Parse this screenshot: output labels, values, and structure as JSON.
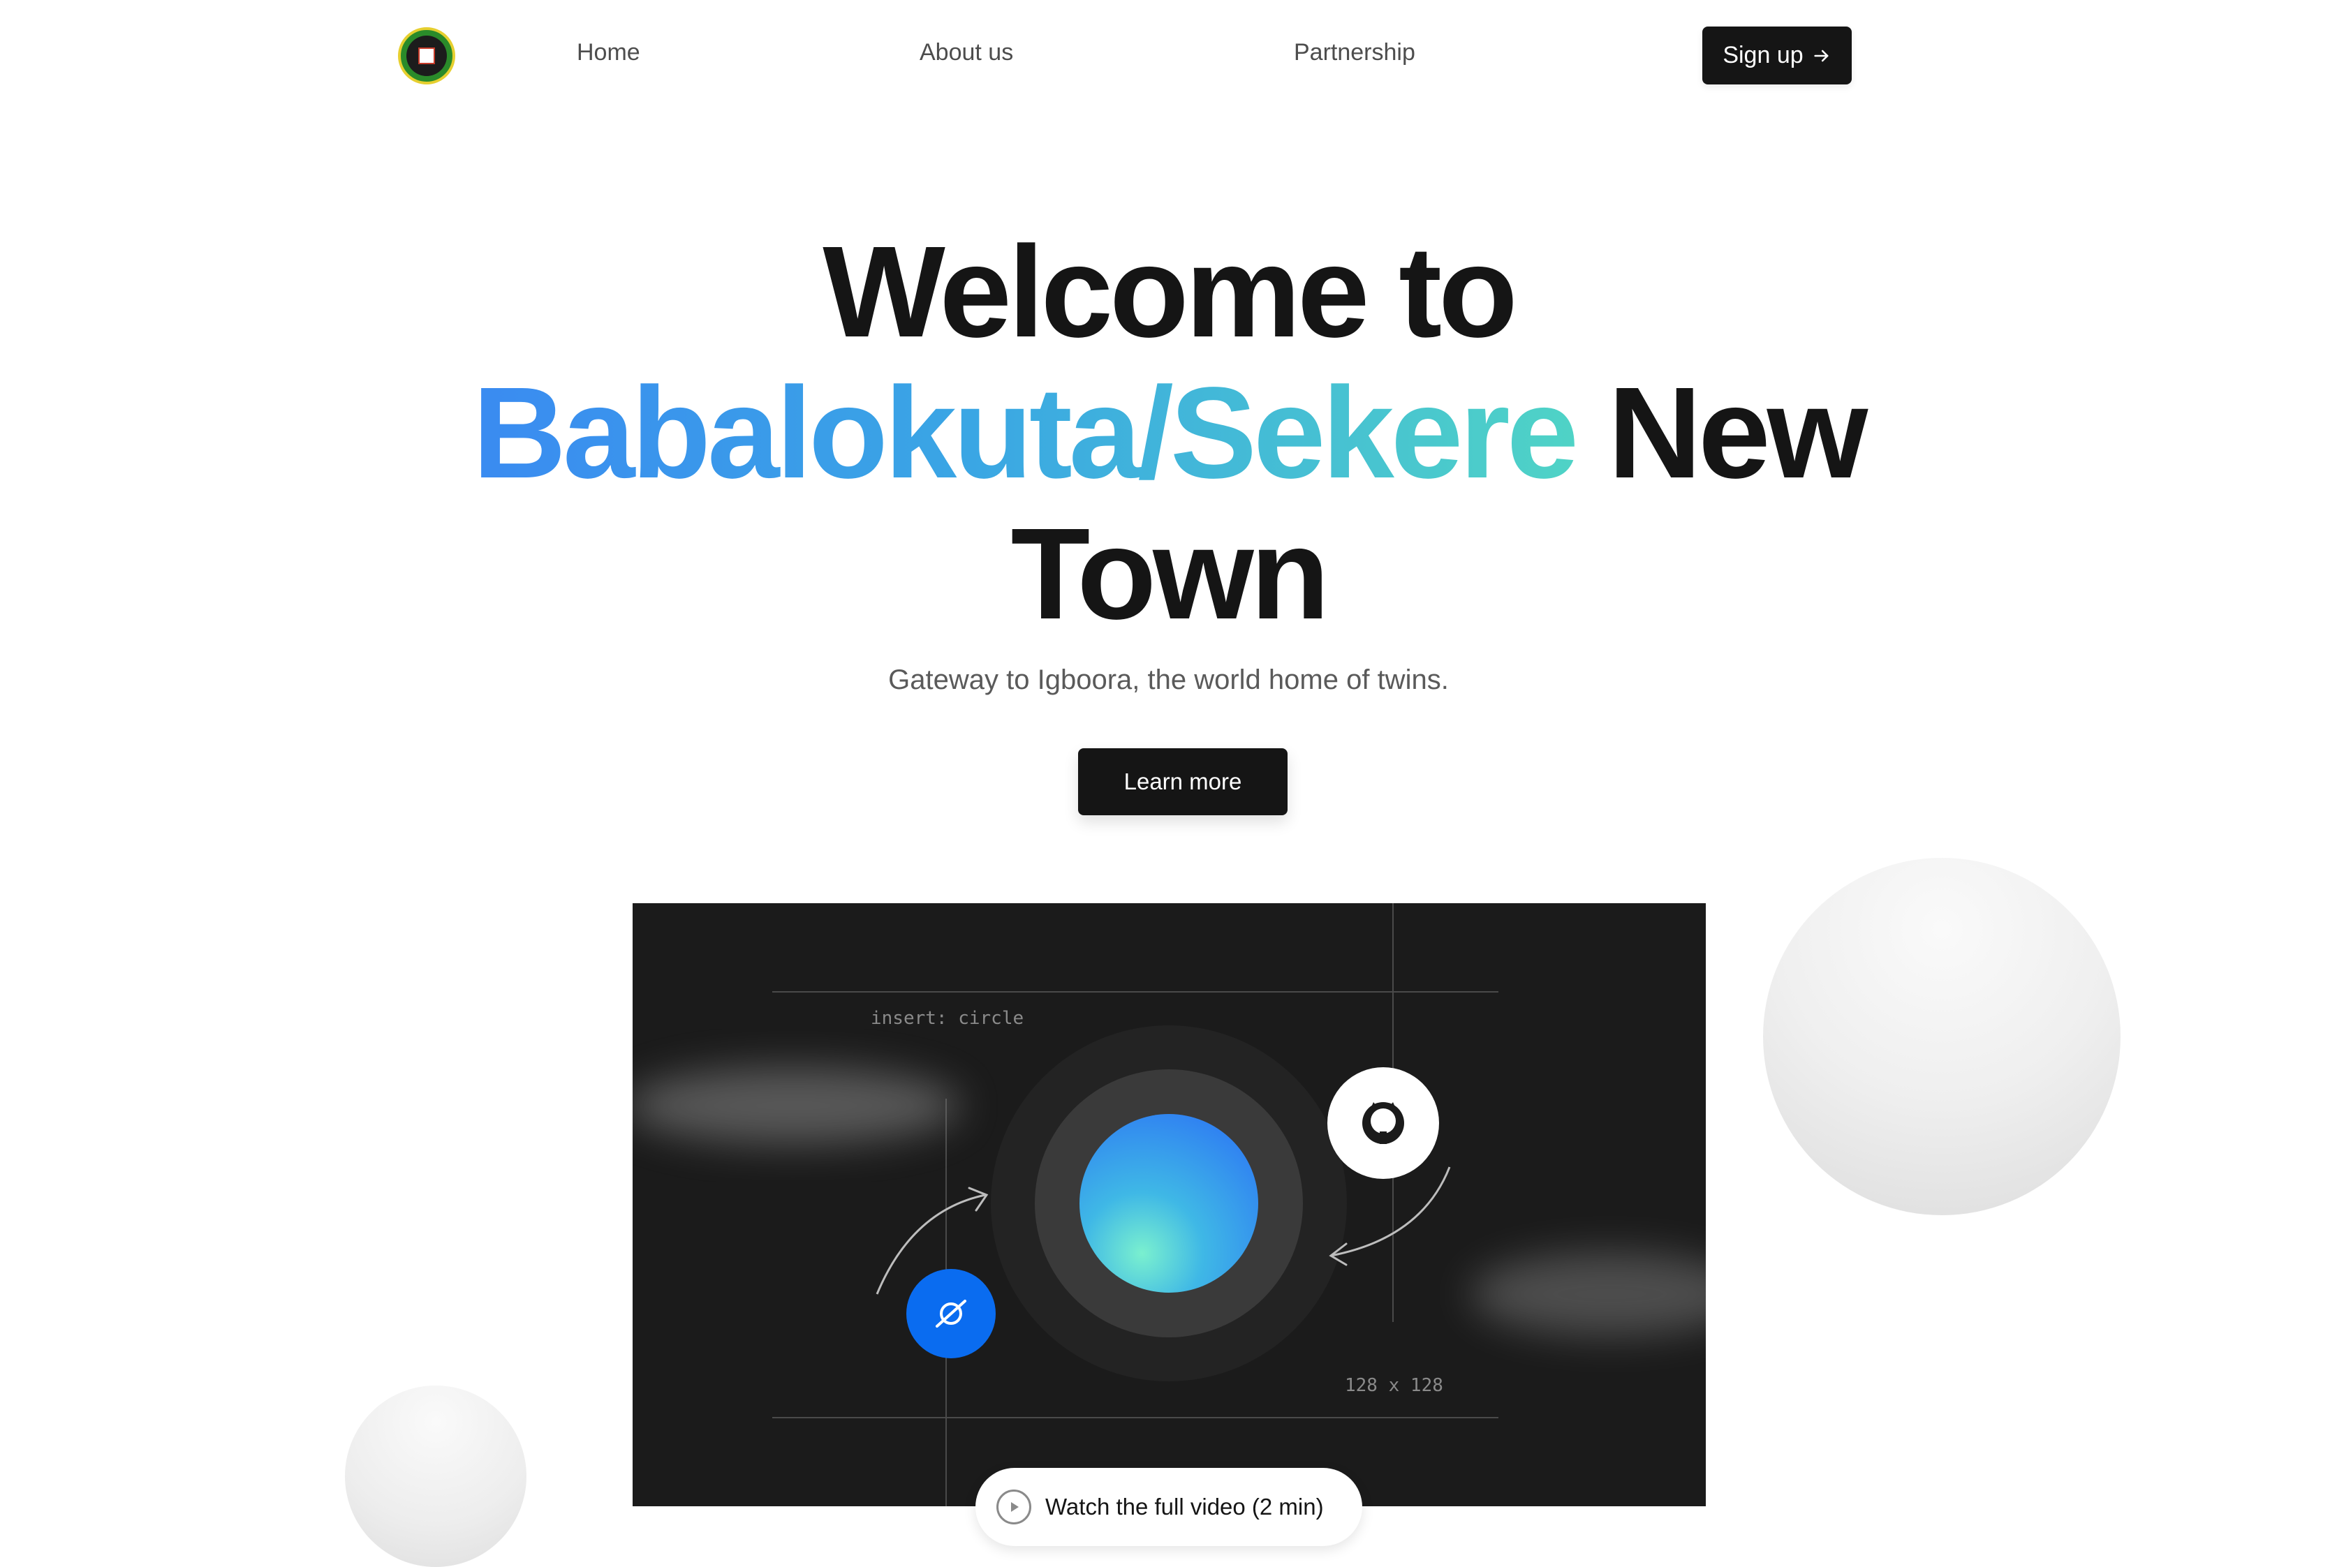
{
  "header": {
    "nav": {
      "home": "Home",
      "about": "About us",
      "partnership": "Partnership"
    },
    "signup_label": "Sign up"
  },
  "hero": {
    "title_line1": "Welcome to",
    "title_highlight": "Babalokuta/Sekere",
    "title_line2_rest": "New",
    "title_line3": "Town",
    "subtitle": "Gateway to Igboora, the world home of twins.",
    "cta_label": "Learn more"
  },
  "video": {
    "annotation_insert": "insert: circle",
    "annotation_size": "128 x 128",
    "watch_label": "Watch the full video (2 min)"
  },
  "colors": {
    "primary_dark": "#151515",
    "gradient_start": "#3a8bf1",
    "gradient_end": "#4fd3c6",
    "accent_blue": "#0a6cf0"
  }
}
